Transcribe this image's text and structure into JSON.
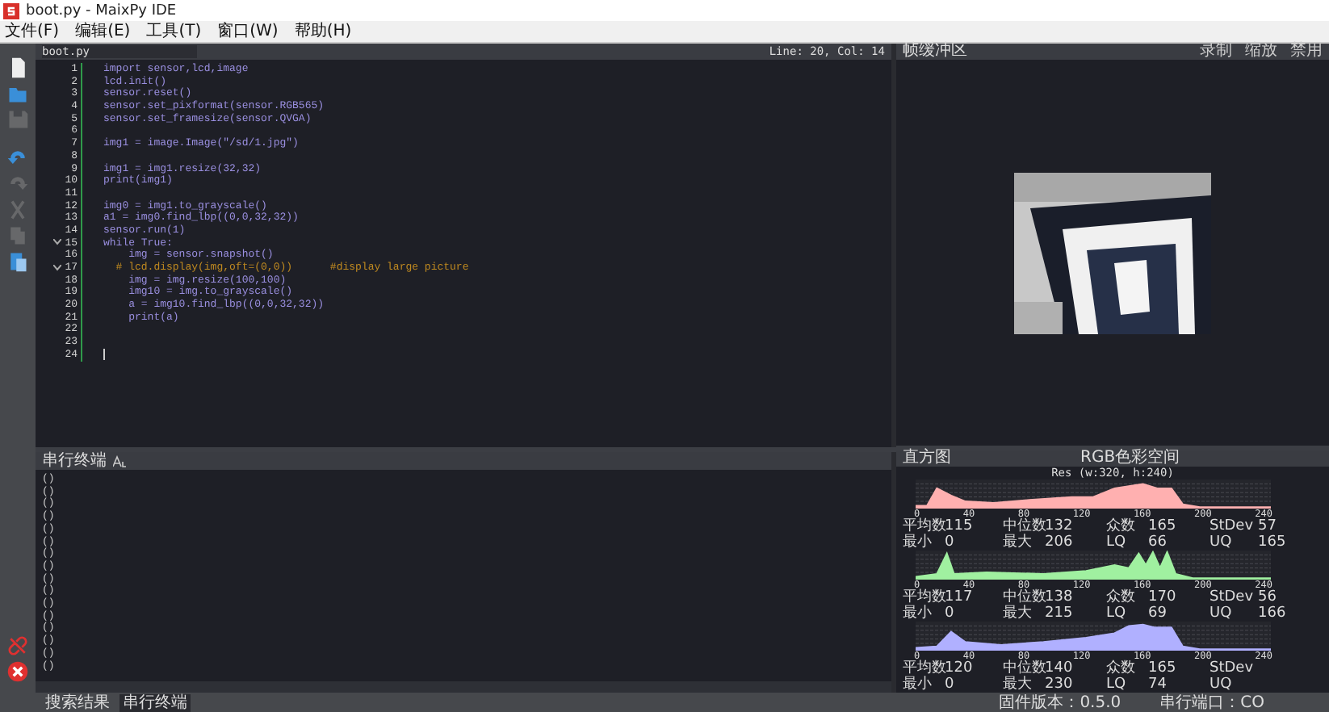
{
  "window": {
    "title": "boot.py - MaixPy IDE"
  },
  "menu": [
    "文件(F)",
    "编辑(E)",
    "工具(T)",
    "窗口(W)",
    "帮助(H)"
  ],
  "toolbar": [
    {
      "disabled": false
    },
    {
      "disabled": false
    },
    {
      "disabled": true
    },
    {
      "disabled": false
    },
    {
      "disabled": true
    },
    {
      "disabled": true
    },
    {
      "disabled": true
    },
    {
      "disabled": false
    }
  ],
  "editor": {
    "tab": "boot.py",
    "cursor": "Line: 20, Col: 14",
    "lines": [
      {
        "number": "1",
        "text": "import sensor,lcd,image",
        "kind": "code",
        "fold": false
      },
      {
        "number": "2",
        "text": "lcd.init()",
        "kind": "code",
        "fold": false
      },
      {
        "number": "3",
        "text": "sensor.reset()",
        "kind": "code",
        "fold": false
      },
      {
        "number": "4",
        "text": "sensor.set_pixformat(sensor.RGB565)",
        "kind": "code",
        "fold": false
      },
      {
        "number": "5",
        "text": "sensor.set_framesize(sensor.QVGA)",
        "kind": "code",
        "fold": false
      },
      {
        "number": "6",
        "fold": false
      },
      {
        "number": "7",
        "text": "img1 = image.Image(\"/sd/1.jpg\")",
        "kind": "code",
        "fold": false
      },
      {
        "number": "8",
        "fold": false
      },
      {
        "number": "9",
        "text": "img1 = img1.resize(32,32)",
        "kind": "code",
        "fold": false
      },
      {
        "number": "10",
        "text": "print(img1)",
        "kind": "code",
        "fold": false
      },
      {
        "number": "11",
        "fold": false
      },
      {
        "number": "12",
        "text": "img0 = img1.to_grayscale()",
        "kind": "code",
        "fold": false
      },
      {
        "number": "13",
        "text": "a1 = img0.find_lbp((0,0,32,32))",
        "kind": "code",
        "fold": false
      },
      {
        "number": "14",
        "text": "sensor.run(1)",
        "kind": "code",
        "fold": false
      },
      {
        "number": "15",
        "text": "while True:",
        "kind": "code",
        "fold": true
      },
      {
        "number": "16",
        "text": "    img = sensor.snapshot()",
        "kind": "code",
        "fold": false
      },
      {
        "number": "17",
        "text": "  # lcd.display(img,oft=(0,0))      #display large picture",
        "kind": "comment",
        "fold": true
      },
      {
        "number": "18",
        "text": "    img = img.resize(100,100)",
        "kind": "code",
        "fold": false
      },
      {
        "number": "19",
        "text": "    img10 = img.to_grayscale()",
        "kind": "code",
        "fold": false
      },
      {
        "number": "20",
        "text": "    a = img10.find_lbp((0,0,32,32))",
        "kind": "code",
        "fold": false
      },
      {
        "number": "21",
        "text": "    print(a)",
        "kind": "code",
        "fold": false
      },
      {
        "number": "22",
        "fold": false
      },
      {
        "number": "23",
        "fold": false
      },
      {
        "number": "24",
        "fold": false,
        "caret": true
      }
    ]
  },
  "frame_buffer": {
    "title": "帧缓冲区",
    "buttons": [
      "录制",
      "缩放",
      "禁用"
    ]
  },
  "terminal": {
    "title": "串行终端",
    "lines": [
      "()",
      "()",
      "()",
      "()",
      "()",
      "()",
      "()",
      "()",
      "()",
      "()",
      "()",
      "()",
      "()",
      "()",
      "()",
      "()"
    ]
  },
  "histogram": {
    "title": "直方图",
    "color_space": "RGB色彩空间",
    "resolution": "Res (w:320, h:240)",
    "channels": [
      {
        "color": "#ffb0b0",
        "x_ticks": [
          "0",
          "40",
          "80",
          "120",
          "160",
          "200",
          "240"
        ],
        "stats": [
          [
            "平均数",
            "115"
          ],
          [
            "中位数",
            "132"
          ],
          [
            "众数",
            "165"
          ],
          [
            "StDev",
            "57"
          ],
          [
            "最小",
            "0"
          ],
          [
            "最大",
            "206"
          ],
          [
            "LQ",
            "66"
          ],
          [
            "UQ",
            "165"
          ]
        ]
      },
      {
        "color": "#a0f0a0",
        "x_ticks": [
          "0",
          "40",
          "80",
          "120",
          "160",
          "200",
          "240"
        ],
        "stats": [
          [
            "平均数",
            "117"
          ],
          [
            "中位数",
            "138"
          ],
          [
            "众数",
            "170"
          ],
          [
            "StDev",
            "56"
          ],
          [
            "最小",
            "0"
          ],
          [
            "最大",
            "215"
          ],
          [
            "LQ",
            "69"
          ],
          [
            "UQ",
            "166"
          ]
        ]
      },
      {
        "color": "#b0b0ff",
        "x_ticks": [
          "0",
          "40",
          "80",
          "120",
          "160",
          "200",
          "240"
        ],
        "stats": [
          [
            "平均数",
            "120"
          ],
          [
            "中位数",
            "140"
          ],
          [
            "众数",
            "165"
          ],
          [
            "StDev"
          ],
          [
            "最小",
            "0"
          ],
          [
            "最大",
            "230"
          ],
          [
            "LQ",
            "74"
          ],
          [
            "UQ"
          ]
        ]
      }
    ]
  },
  "bottom_tabs": [
    {
      "label": "搜索结果",
      "selected": false
    },
    {
      "label": "串行终端",
      "selected": true
    }
  ],
  "status": {
    "firmware": "固件版本：0.5.0",
    "port": "串行端口：CO"
  }
}
